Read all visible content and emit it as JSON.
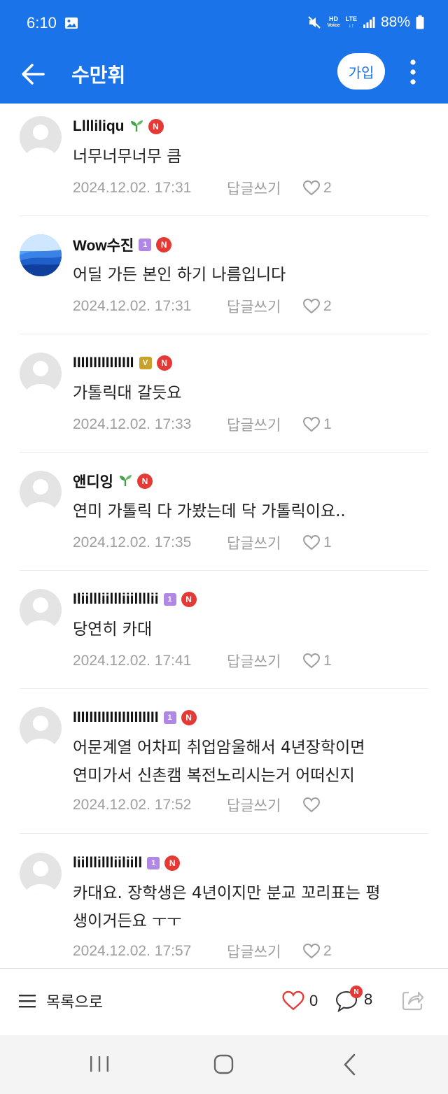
{
  "status": {
    "time": "6:10",
    "battery": "88%",
    "hd_label": "HD",
    "voice_label": "Voice",
    "lte_label": "LTE"
  },
  "appbar": {
    "title": "수만휘",
    "join_label": "가입"
  },
  "colors": {
    "brand": "#1a73e8",
    "badge_new": "#e53935",
    "level_purple": "#b187e6",
    "level_gold": "#c8a22a",
    "like_red": "#e53935",
    "meta_gray": "#9e9e9e"
  },
  "comments": [
    {
      "name": "Lllliliqu",
      "badge": "sprout-icon",
      "new_badge": "N",
      "text": "너무너무너무 큼",
      "date": "2024.12.02. 17:31",
      "reply": "답글쓰기",
      "likes": "2"
    },
    {
      "name": "Wow수진",
      "badge": "level-1",
      "level_label": "1",
      "new_badge": "N",
      "text": "어딜 가든 본인 하기 나름입니다",
      "date": "2024.12.02. 17:31",
      "reply": "답글쓰기",
      "likes": "2"
    },
    {
      "name": "IIIIIIIIIIIIIII",
      "badge": "level-v",
      "level_label": "V",
      "new_badge": "N",
      "text": "가톨릭대 갈듯요",
      "date": "2024.12.02. 17:33",
      "reply": "답글쓰기",
      "likes": "1"
    },
    {
      "name": "앤디잉",
      "badge": "sprout-icon",
      "new_badge": "N",
      "text": "연미 가톨릭 다 가봤는데 닥 가톨릭이요..",
      "date": "2024.12.02. 17:35",
      "reply": "답글쓰기",
      "likes": "1"
    },
    {
      "name": "Iliillliillliiillllii",
      "badge": "level-1",
      "level_label": "1",
      "new_badge": "N",
      "text": "당연히 카대",
      "date": "2024.12.02. 17:41",
      "reply": "답글쓰기",
      "likes": "1"
    },
    {
      "name": "IIIIIIIIIIIIIIIIIIIII",
      "badge": "level-1",
      "level_label": "1",
      "new_badge": "N",
      "text_lines": [
        "어문계열 어차피 취업암울해서 4년장학이면",
        "연미가서 신촌캠 복전노리시는거 어떠신지"
      ],
      "date": "2024.12.02. 17:52",
      "reply": "답글쓰기",
      "likes": ""
    },
    {
      "name": "liilllillliiliill",
      "badge": "level-1",
      "level_label": "1",
      "new_badge": "N",
      "text_lines": [
        "카대요. 장학생은 4년이지만 분교 꼬리표는 평",
        "생이거든요 ㅜㅜ"
      ],
      "date": "2024.12.02. 17:57",
      "reply": "답글쓰기",
      "likes": "2"
    }
  ],
  "bottom": {
    "list_label": "목록으로",
    "like_count": "0",
    "comment_count": "8",
    "comment_new_badge": "N"
  }
}
